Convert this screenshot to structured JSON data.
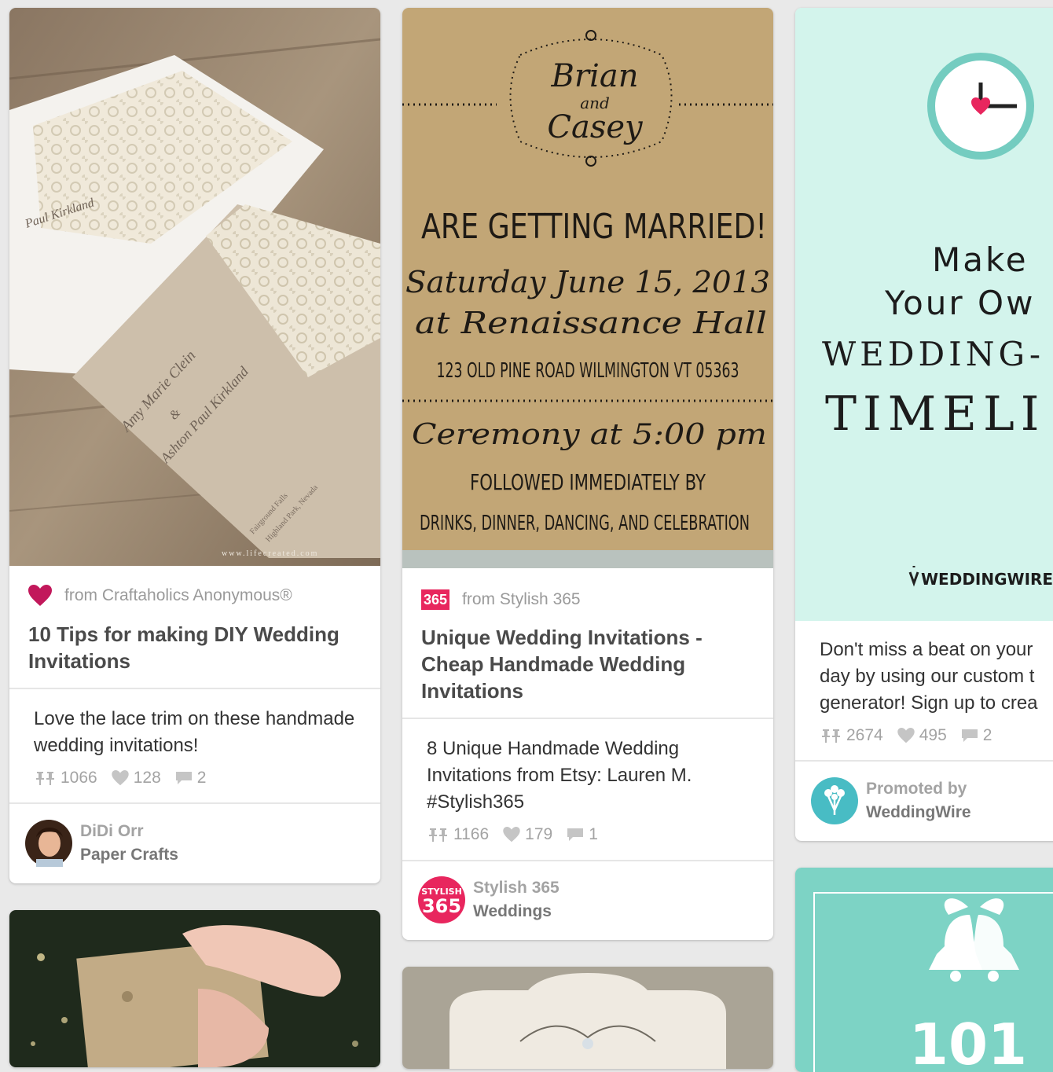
{
  "pins": [
    {
      "source": "from Craftaholics Anonymous®",
      "title": "10 Tips for making DIY Wedding Invitations",
      "description": "Love the lace trim on these handmade wedding invitations!",
      "repins": "1066",
      "likes": "128",
      "comments": "2",
      "pinner": "DiDi Orr",
      "board": "Paper Crafts",
      "image_lines": [
        "Paul Kirkland",
        "Amy Marie Clein",
        "&",
        "Ashton Paul Kirkland",
        "Fairground Falls",
        "Highland Park, Nevada",
        "www.lifecreated.com"
      ]
    },
    {
      "source": "from Stylish 365",
      "source_badge": "365",
      "title": "Unique Wedding Invitations - Cheap Handmade Wedding Invitations",
      "description": "8 Unique Handmade Wedding Invitations from Etsy: Lauren M. #Stylish365",
      "repins": "1166",
      "likes": "179",
      "comments": "1",
      "pinner": "Stylish 365",
      "board": "Weddings",
      "avatar_top": "STYLISH",
      "avatar_num": "365",
      "image_lines": [
        "Brian",
        "and",
        "Casey",
        "ARE GETTING MARRIED!",
        "Saturday June 15, 2013",
        "at Renaissance Hall",
        "123 OLD PINE ROAD WILMINGTON VT 05363",
        "Ceremony at 5:00 pm",
        "FOLLOWED IMMEDIATELY BY",
        "DRINKS, DINNER, DANCING, AND CELEBRATION"
      ]
    },
    {
      "description": "Don't miss a beat on your day by using our custom t generator! Sign up to crea",
      "repins": "2674",
      "likes": "495",
      "comments": "2",
      "promoted_label": "Promoted by",
      "promoter": "WeddingWire",
      "image_lines": [
        "Make",
        "Your Ow",
        "WEDDING-",
        "TIMELI",
        "WEDDINGWIRE"
      ]
    },
    {
      "image_text": "101"
    }
  ],
  "colors": {
    "background": "#e9e9e9",
    "heart": "#c2185b",
    "stylish_red": "#e8265e",
    "mint": "#d3f4ec",
    "teal": "#74ccc0",
    "kraft": "#c2a676"
  }
}
